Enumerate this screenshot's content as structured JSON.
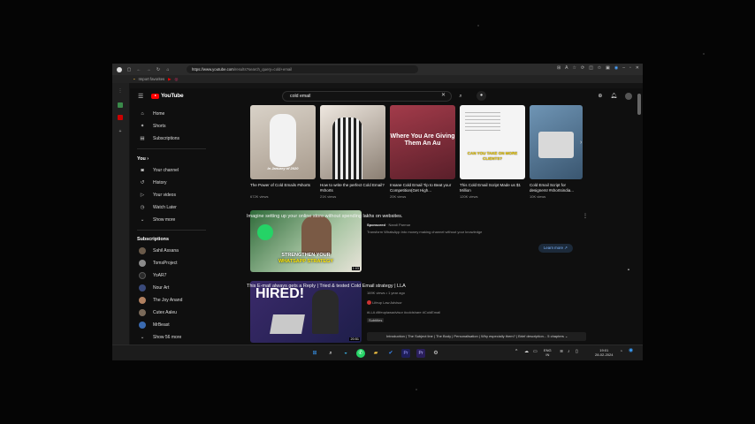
{
  "browser": {
    "url_host": "https://www.youtube.com",
    "url_path": "/results?search_query=cold+email",
    "favorites": [
      "Import favorites"
    ]
  },
  "youtube": {
    "logo_text": "YouTube",
    "search_query": "cold email",
    "sidebar": {
      "main": [
        "Home",
        "Shorts",
        "Subscriptions"
      ],
      "you_header": "You",
      "you_items": [
        "Your channel",
        "History",
        "Your videos",
        "Watch Later",
        "Show more"
      ],
      "subs_header": "Subscriptions",
      "subs": [
        "Sahil Assana",
        "TomsProject",
        "YoAR7",
        "Nour Art",
        "The Joy Anand",
        "Cutex Aaleu",
        "MrBeast"
      ],
      "show_more_subs": "Show 56 more"
    },
    "shorts": [
      {
        "title": "The Power of Cold Emails #shorts",
        "views": "672K views",
        "overlay": "In January of 2020"
      },
      {
        "title": "How to write the perfect Cold Email? #shorts",
        "views": "21K views",
        "overlay": ""
      },
      {
        "title": "Insane Cold Email Tip to Beat your Competition(Get High...",
        "views": "20K views",
        "overlay": "Where You Are Giving Them An Au"
      },
      {
        "title": "This Cold Email Script Made us $1 Million",
        "views": "120K views",
        "overlay": "CAN YOU TAKE ON MORE CLIENTS?"
      },
      {
        "title": "Cold Email Script for designers! #shortsindia...",
        "views": "10K views",
        "overlay": ""
      }
    ],
    "videos": [
      {
        "title": "Imagine setting up your online store without spending lakhs on websites.",
        "sponsored": "Sponsored",
        "channel": "Nandi Parmar",
        "description": "Transform WhatsApp into money making channel without your knowledge",
        "thumb_text": "STRENGTHEN YOUR",
        "thumb_text2": "WHATSAPP STRATEGY",
        "duration": "1:03",
        "cta": "Learn more"
      },
      {
        "title": "This E-mail always gets a Reply | Tried & tested Cold Email strategy | LLA",
        "meta": "169K views • 1 year ago",
        "channel": "Lifeup Law Advisor",
        "description": "#LLA #lifeuplawadvisor #coldshare #ColdEmail",
        "badge": "Subtitles",
        "thumb_text": "HIRED!",
        "duration": "20:51",
        "chapters": "Introduction | The Subject line | The Body | Personalisation | Why especially them? | Brief description... 5 chapters"
      }
    ]
  },
  "taskbar": {
    "lang": "ENG",
    "region": "IN",
    "time": "19:01",
    "date": "28-02-2024"
  },
  "colors": {
    "accent": "#ff0000",
    "bg": "#0f0f0f"
  }
}
